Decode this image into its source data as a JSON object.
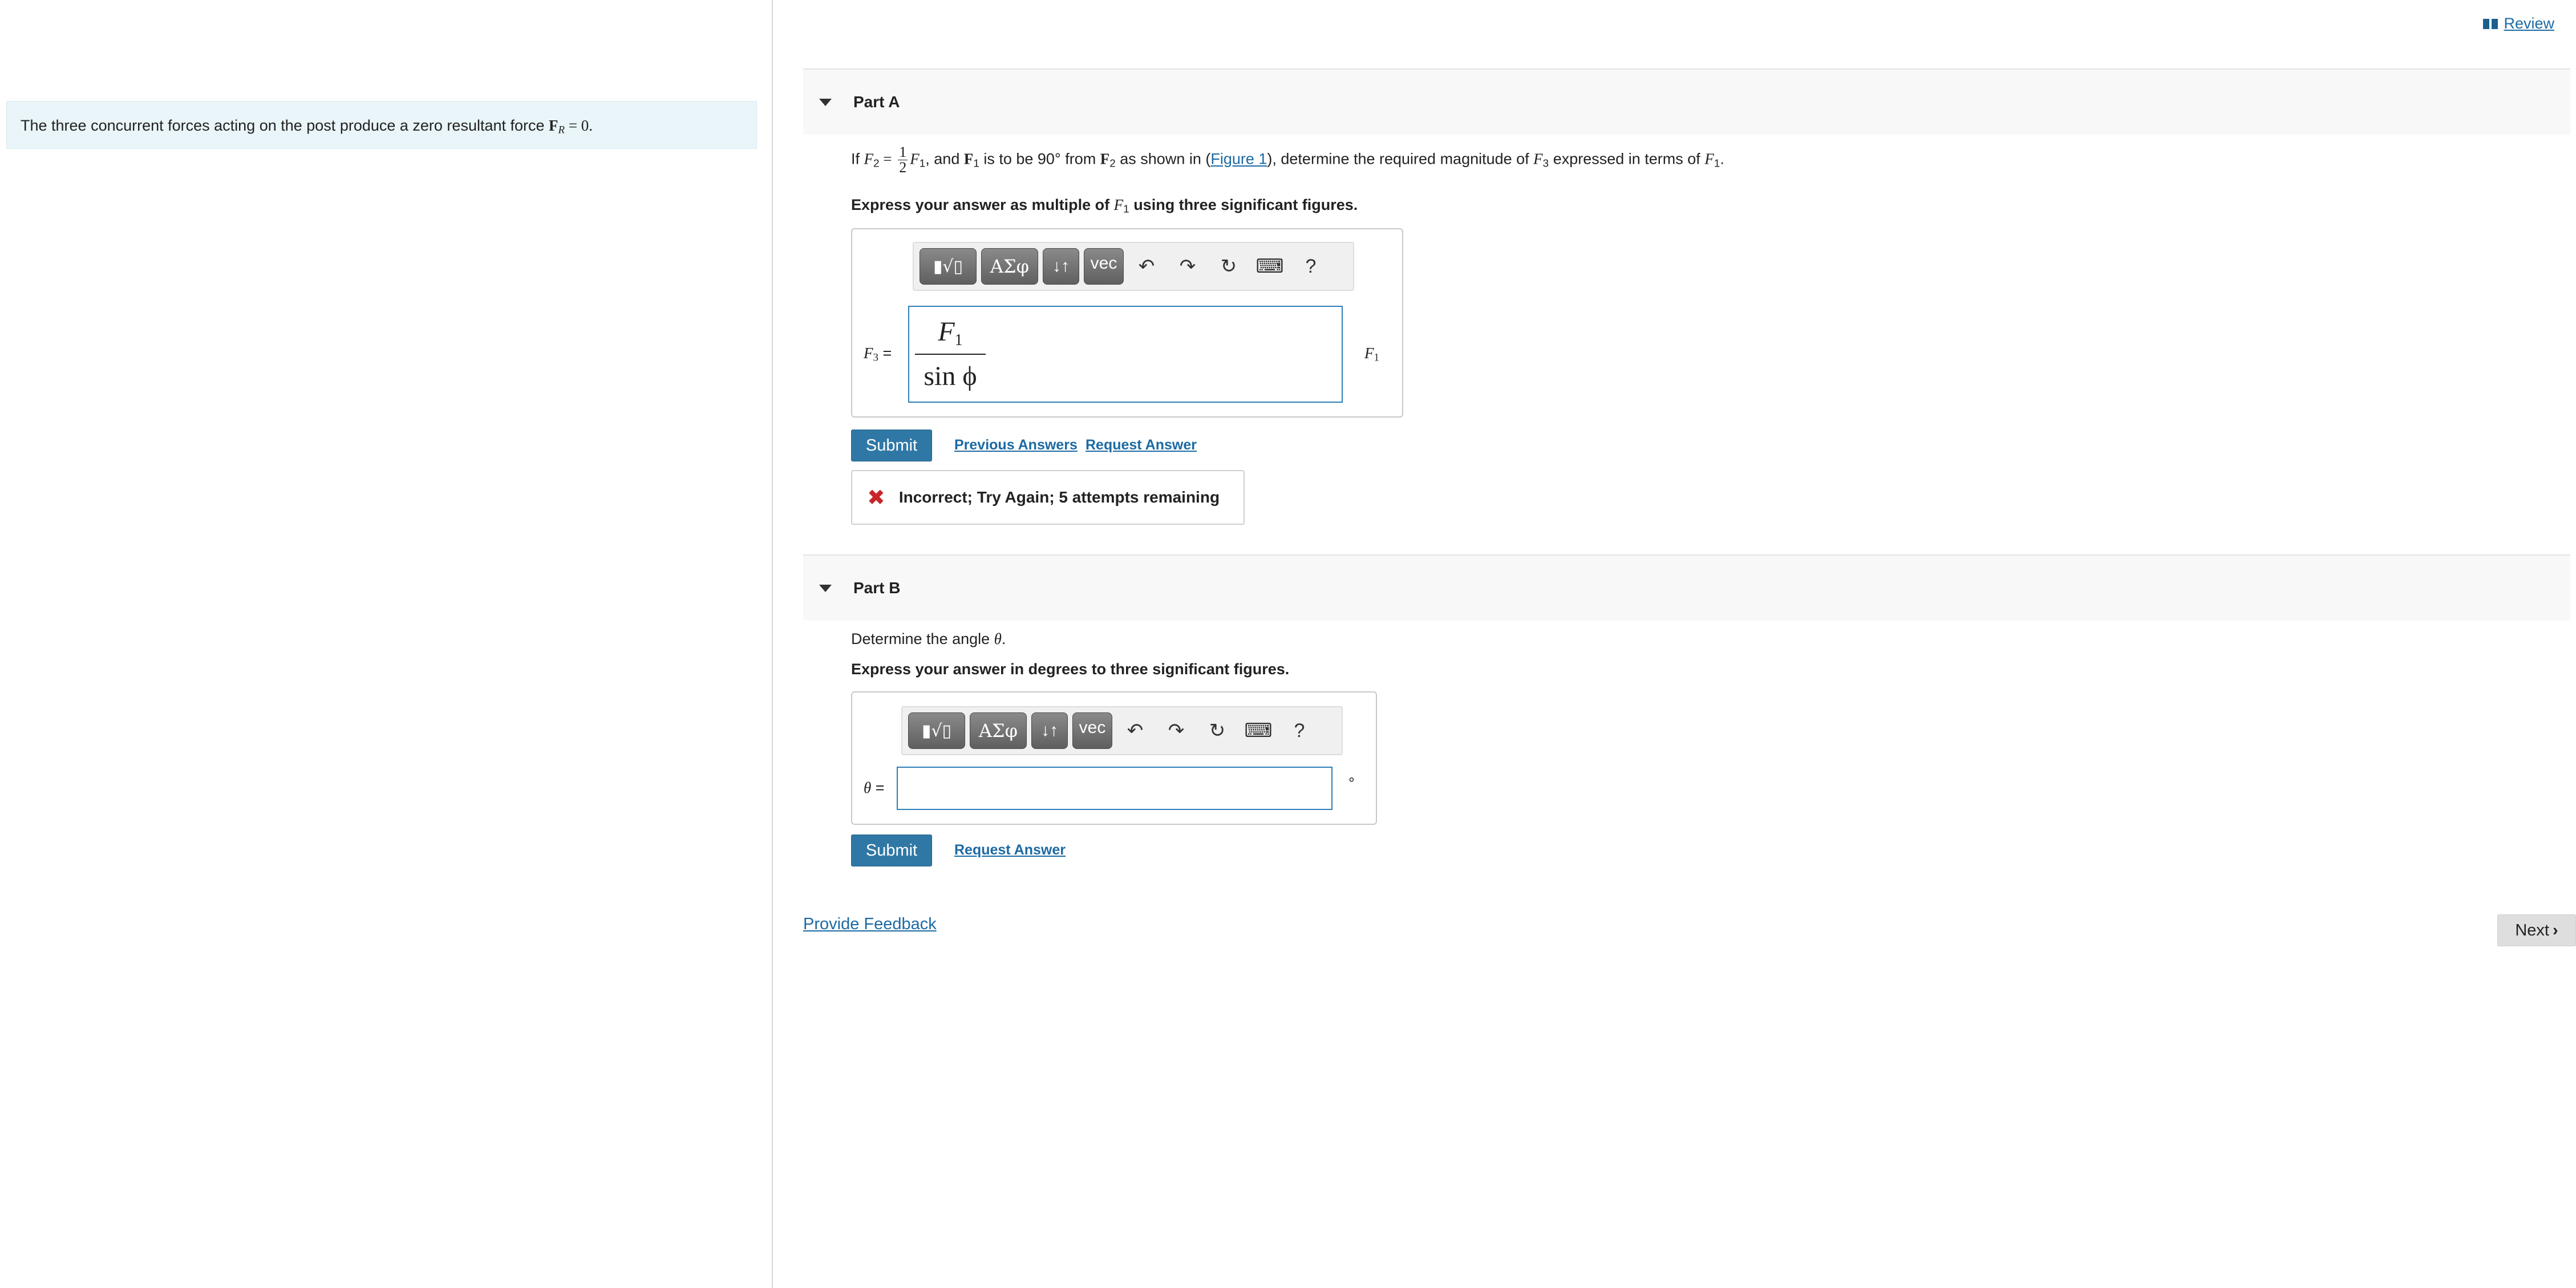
{
  "header": {
    "review_label": "Review"
  },
  "intro": {
    "text": "The three concurrent forces acting on the post produce a zero resultant force ",
    "force_symbol": "F",
    "force_sub": "R",
    "force_tail": " = 0."
  },
  "part_a": {
    "title": "Part A",
    "q_if": "If ",
    "q_f2": "F",
    "q_f2_sub": "2",
    "q_eq": " = ",
    "q_frac_num": "1",
    "q_frac_den": "2",
    "q_f1": "F",
    "q_f1_sub": "1",
    "q_and": ", and ",
    "q_bf1": "F",
    "q_bf1_sub": "1",
    "q_mid": " is to be 90° from ",
    "q_bf2": "F",
    "q_bf2_sub": "2",
    "q_shown": " as shown in (",
    "q_figure": "Figure 1",
    "q_after": "), determine the required magnitude of ",
    "q_f3": "F",
    "q_f3_sub": "3",
    "q_terms": " expressed in terms of ",
    "q_f1b": "F",
    "q_f1b_sub": "1",
    "q_end": ".",
    "instruction_a": "Express your answer as multiple of ",
    "instruction_f": "F",
    "instruction_f_sub": "1",
    "instruction_b": " using three significant figures.",
    "var_label": "F",
    "var_sub": "3",
    "var_eq": " =",
    "answer_num": "F",
    "answer_num_sub": "1",
    "answer_den": "sin ϕ",
    "unit": "F",
    "unit_sub": "1",
    "submit_label": "Submit",
    "previous_answers_label": "Previous Answers",
    "request_answer_label": "Request Answer",
    "feedback_text": "Incorrect; Try Again; 5 attempts remaining"
  },
  "part_b": {
    "title": "Part B",
    "question_a": "Determine the angle ",
    "question_theta": "θ",
    "question_b": ".",
    "instruction": "Express your answer in degrees to three significant figures.",
    "var_label": "θ",
    "var_eq": " =",
    "unit": "°",
    "submit_label": "Submit",
    "request_answer_label": "Request Answer"
  },
  "toolbar": {
    "templates": "▮√▯",
    "greek": "ΑΣφ",
    "updown": "↓↑",
    "vec": "vec",
    "help": "?"
  },
  "footer": {
    "provide_feedback_label": "Provide Feedback",
    "next_label": "Next"
  }
}
